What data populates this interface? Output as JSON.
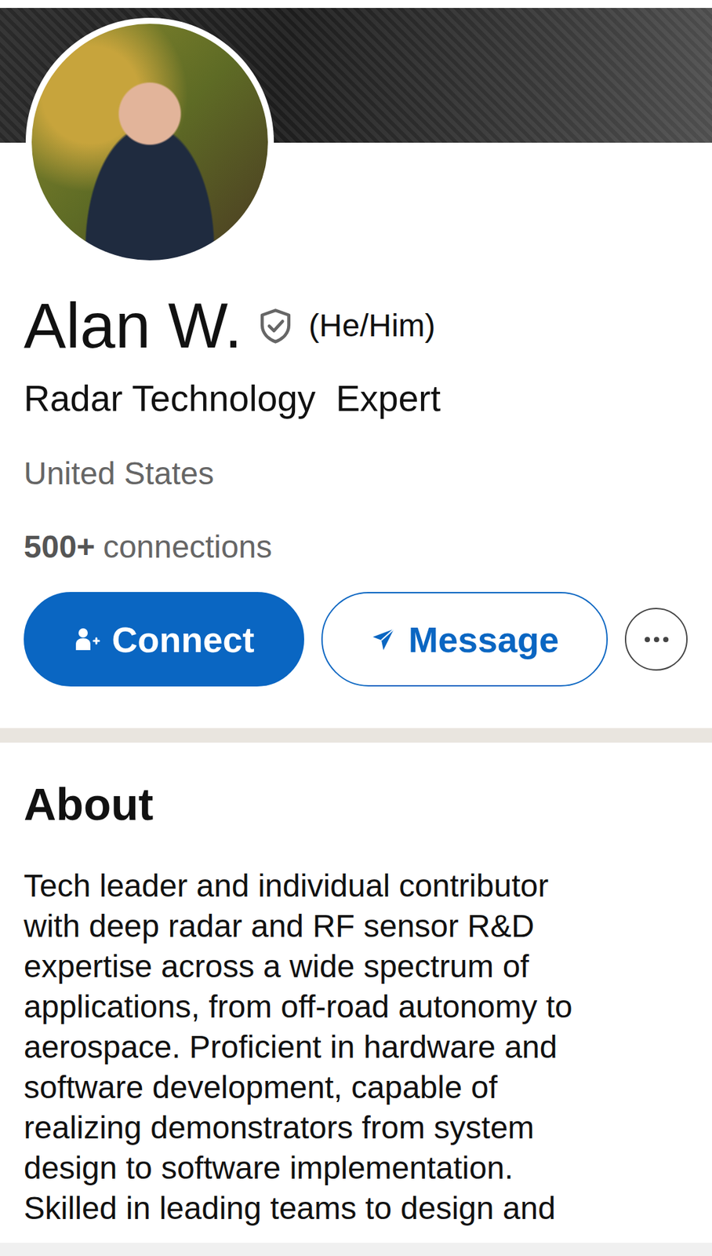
{
  "profile": {
    "name": "Alan W.",
    "verified": true,
    "pronouns": "(He/Him)",
    "headline": "Radar Technology  Expert",
    "location": "United States",
    "connections_count": "500+",
    "connections_label": "connections"
  },
  "actions": [
    {
      "label": "Connect",
      "kind": "primary"
    },
    {
      "label": "Message",
      "kind": "secondary"
    }
  ],
  "about": {
    "title": "About",
    "lines": [
      "Tech leader and individual contributor",
      "with deep radar and RF sensor R&D",
      "expertise across a wide spectrum of",
      "applications, from off-road autonomy to",
      "aerospace. Proficient in hardware and",
      "software development, capable of",
      "realizing demonstrators from system",
      "design to software implementation.",
      "Skilled in leading teams to design and"
    ]
  }
}
